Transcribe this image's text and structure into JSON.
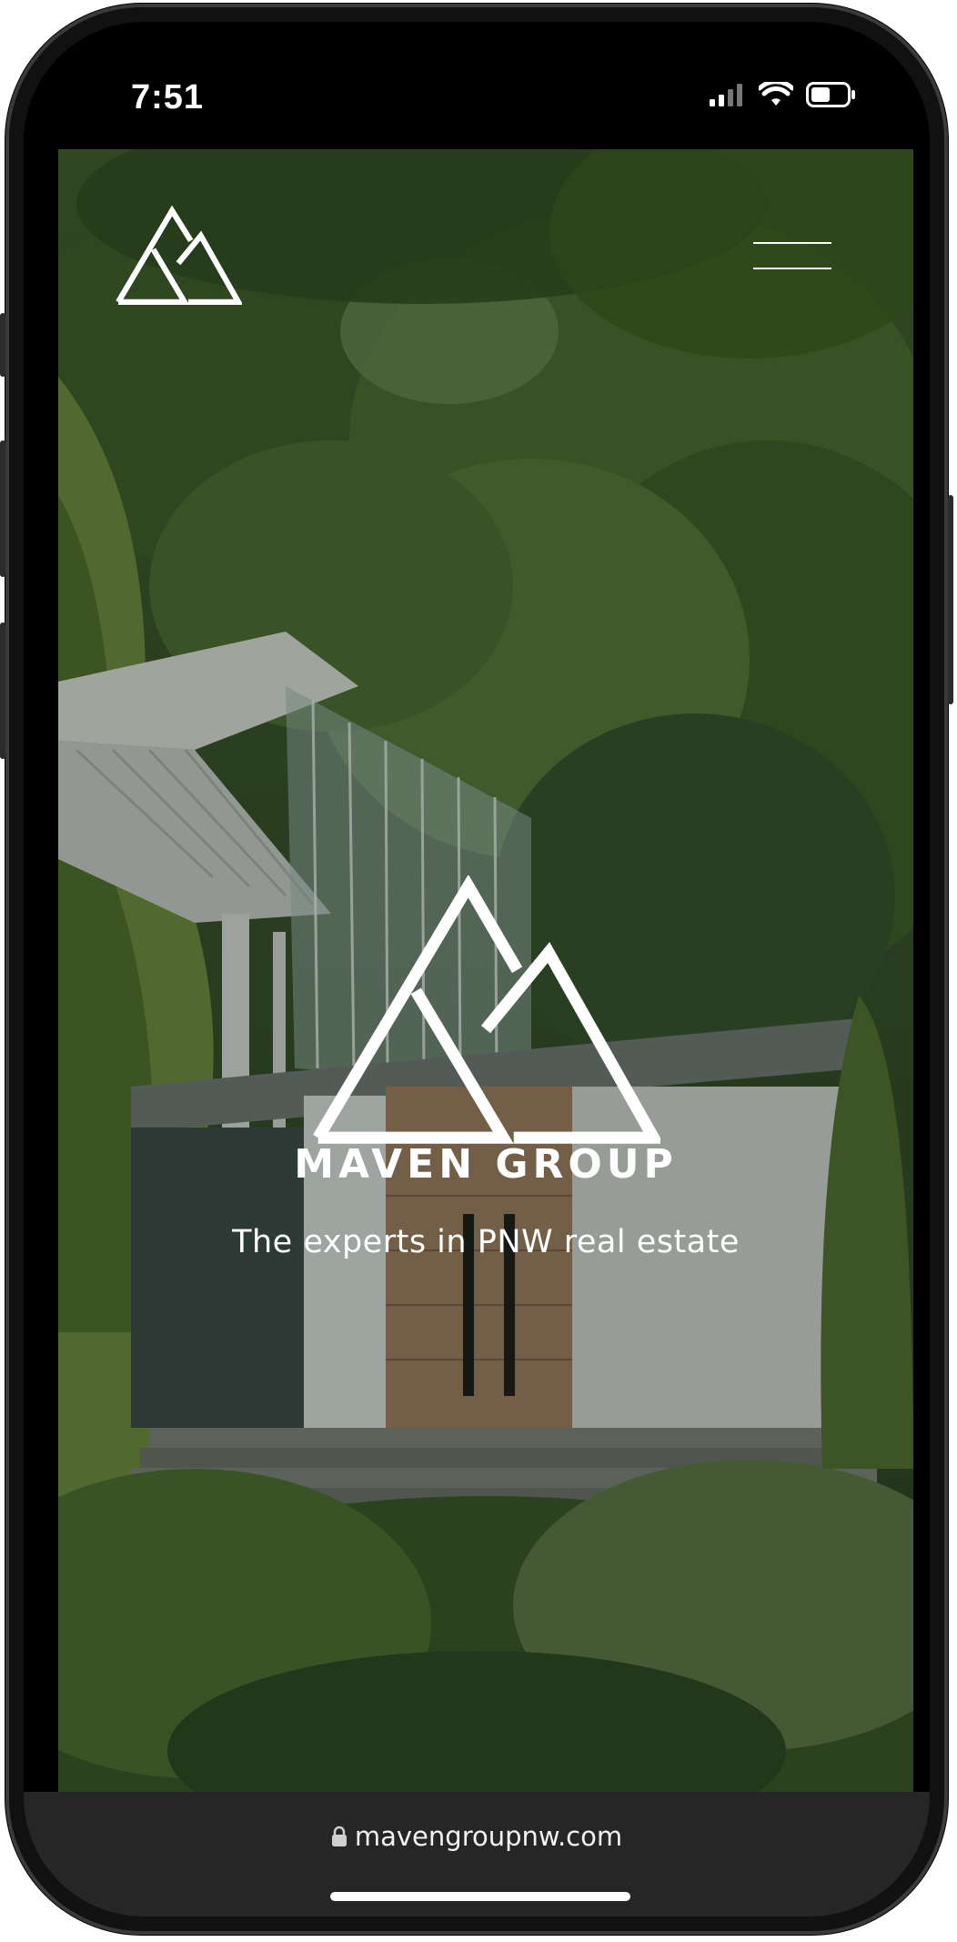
{
  "status_bar": {
    "time": "7:51",
    "icons": [
      "signal-icon",
      "wifi-icon",
      "battery-icon"
    ]
  },
  "header": {
    "logo_icon": "maven-mountain-logo-icon",
    "menu_icon": "hamburger-menu-icon"
  },
  "hero": {
    "brand_name": "MAVEN GROUP",
    "tagline": "The experts in PNW real estate",
    "logo_icon": "maven-mountain-logo-icon"
  },
  "browser": {
    "lock_icon": "lock-icon",
    "url": "mavengroupnw.com"
  },
  "colors": {
    "phone_frame": "#111111",
    "browser_bar": "#262626",
    "text": "#ffffff",
    "foliage_dark": "#2f4424",
    "foliage_light": "#6d8a3e"
  }
}
